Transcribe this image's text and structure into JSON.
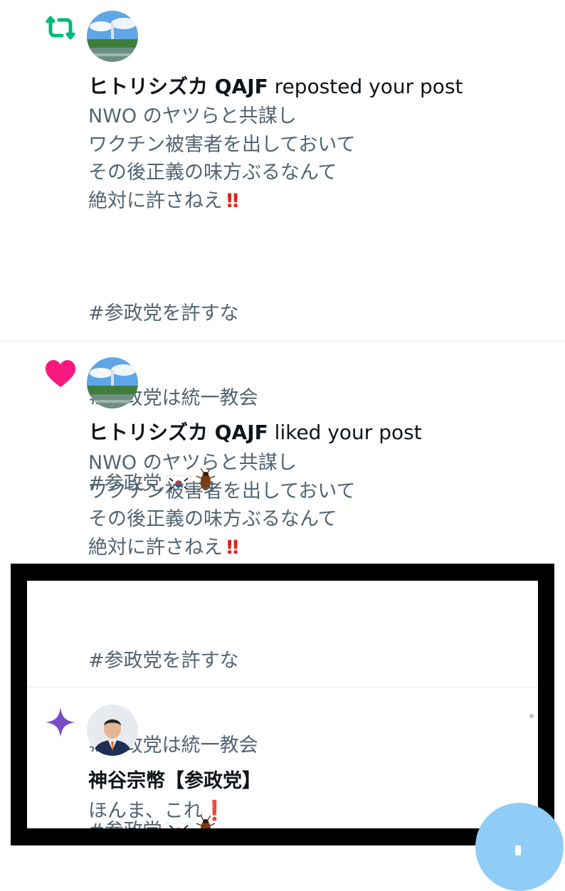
{
  "notifications": [
    {
      "type": "repost",
      "icon": "repost-icon",
      "user_name": "ヒトリシズカ QAJF",
      "action_text": " reposted your post",
      "post_text": "NWO のヤツらと共謀し\nワクチン被害者を出しておいて\nその後正義の味方ぶるなんて\n絶対に許さねえ",
      "hashtags": [
        "#参政党を許すな",
        "#参政党は統一教会",
        "#参政党"
      ]
    },
    {
      "type": "like",
      "icon": "heart-icon",
      "user_name": "ヒトリシズカ QAJF",
      "action_text": " liked your post",
      "post_text": "NWO のヤツらと共謀し\nワクチン被害者を出しておいて\nその後正義の味方ぶるなんて\n絶対に許さねえ",
      "hashtags": [
        "#参政党を許すな",
        "#参政党は統一教会",
        "#参政党"
      ]
    },
    {
      "type": "recommended",
      "icon": "sparkle-icon",
      "user_name": "神谷宗幣【参政党】",
      "post_text": "ほんま、これ"
    }
  ],
  "colors": {
    "repost": "#00ba7c",
    "like": "#f91880",
    "sparkle": "#794bc4",
    "fab": "#8fcdf6",
    "secondary_text": "#536471"
  }
}
